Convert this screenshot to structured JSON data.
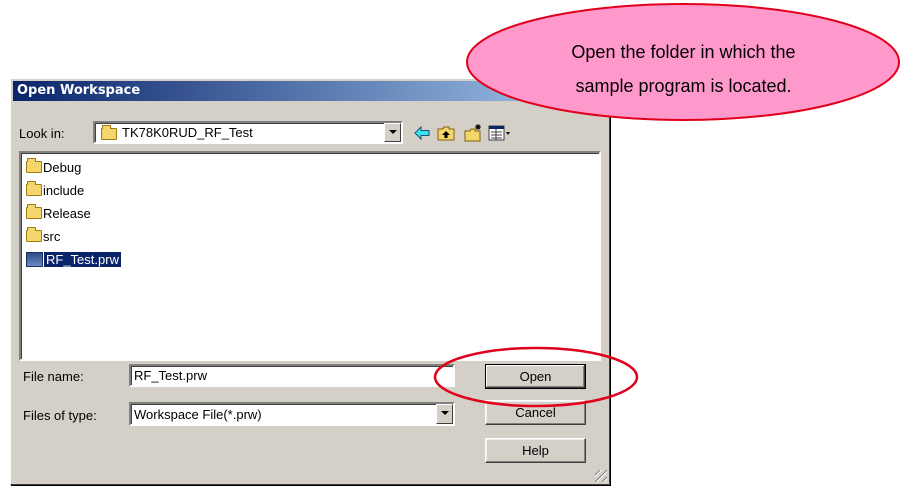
{
  "dialog": {
    "title": "Open Workspace",
    "look_in_label": "Look in:",
    "look_in_value": "TK78K0RUD_RF_Test",
    "toolbar_icons": [
      "back-icon",
      "up-folder-icon",
      "new-folder-icon",
      "view-menu-icon"
    ],
    "files": [
      {
        "name": "Debug",
        "icon": "folder-icon",
        "selected": false
      },
      {
        "name": "include",
        "icon": "folder-icon",
        "selected": false
      },
      {
        "name": "Release",
        "icon": "folder-icon",
        "selected": false
      },
      {
        "name": "src",
        "icon": "folder-icon",
        "selected": false
      },
      {
        "name": "RF_Test.prw",
        "icon": "workspace-file-icon",
        "selected": true
      }
    ],
    "file_name_label": "File name:",
    "file_name_value": "RF_Test.prw",
    "files_of_type_label": "Files of type:",
    "files_of_type_value": "Workspace File(*.prw)",
    "open_label": "Open",
    "cancel_label": "Cancel",
    "help_label": "Help"
  },
  "callout": {
    "line1": "Open the folder in which the",
    "line2": "sample program is located.",
    "fill_color": "#ff99cc",
    "border_color": "#e0001b"
  },
  "highlight": {
    "target": "open-button",
    "color": "#e0001b"
  }
}
